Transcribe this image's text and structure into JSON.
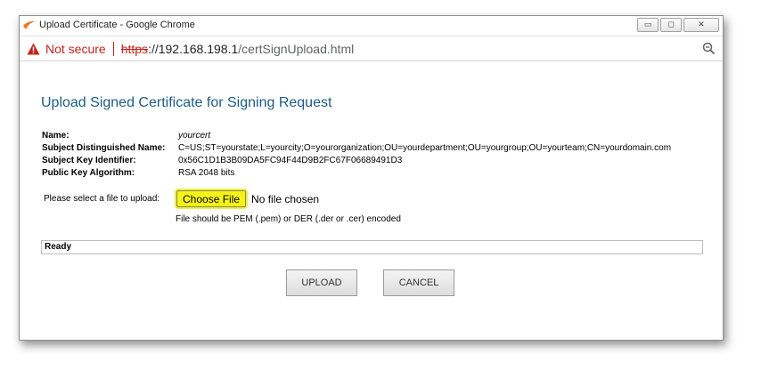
{
  "window": {
    "title": "Upload Certificate - Google Chrome",
    "controls": {
      "minimize": "▭",
      "maximize": "◻",
      "close": "✕"
    }
  },
  "address_bar": {
    "security_text": "Not secure",
    "url_scheme": "https",
    "url_sep": "://",
    "url_host": "192.168.198.1",
    "url_path": "/certSignUpload.html"
  },
  "page": {
    "title": "Upload Signed Certificate for Signing Request",
    "info": [
      {
        "label": "Name:",
        "value": "yourcert"
      },
      {
        "label": "Subject Distinguished Name:",
        "value": "C=US;ST=yourstate;L=yourcity;O=yourorganization;OU=yourdepartment;OU=yourgroup;OU=yourteam;CN=yourdomain.com"
      },
      {
        "label": "Subject Key Identifier:",
        "value": "0x56C1D1B3B09DA5FC94F44D9B2FC67F06689491D3"
      },
      {
        "label": "Public Key Algorithm:",
        "value": "RSA 2048 bits"
      }
    ],
    "upload_label": "Please select a file to upload:",
    "choose_file": "Choose File",
    "no_file": "No file chosen",
    "hint": "File should be PEM (.pem) or DER (.der or .cer) encoded",
    "status": "Ready",
    "upload_button": "UPLOAD",
    "cancel_button": "CANCEL"
  },
  "colors": {
    "title_blue": "#1d5b85",
    "warning_red": "#c5221f",
    "highlight_yellow": "#f5f31a"
  }
}
